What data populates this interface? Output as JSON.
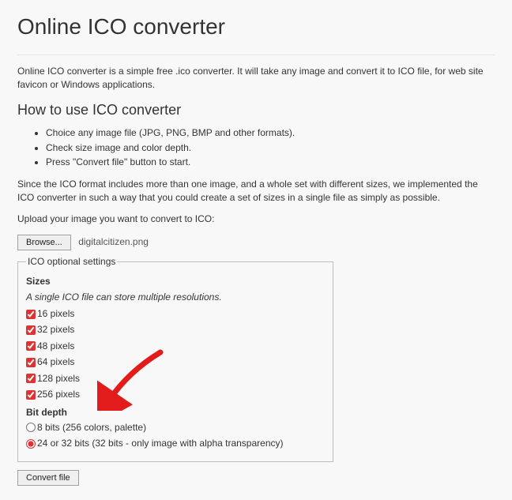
{
  "header": {
    "title": "Online ICO converter"
  },
  "intro": "Online ICO converter is a simple free .ico converter. It will take any image and convert it to ICO file, for web site favicon or Windows applications.",
  "howto": {
    "heading": "How to use ICO converter",
    "steps": [
      "Choice any image file (JPG, PNG, BMP and other formats).",
      "Check size image and color depth.",
      "Press \"Convert file\" button to start."
    ]
  },
  "note": "Since the ICO format includes more than one image, and a whole set with different sizes, we implemented the ICO converter in such a way that you could create a set of sizes in a single file as simply as possible.",
  "upload": {
    "label": "Upload your image you want to convert to ICO:",
    "browse_label": "Browse...",
    "filename": "digitalcitizen.png"
  },
  "settings": {
    "legend": "ICO optional settings",
    "sizes": {
      "title": "Sizes",
      "subtitle": "A single ICO file can store multiple resolutions.",
      "options": [
        {
          "label": "16 pixels",
          "checked": true
        },
        {
          "label": "32 pixels",
          "checked": true
        },
        {
          "label": "48 pixels",
          "checked": true
        },
        {
          "label": "64 pixels",
          "checked": true
        },
        {
          "label": "128 pixels",
          "checked": true
        },
        {
          "label": "256 pixels",
          "checked": true
        }
      ]
    },
    "bitdepth": {
      "title": "Bit depth",
      "options": [
        {
          "label": "8 bits (256 colors, palette)",
          "selected": false
        },
        {
          "label": "24 or 32 bits (32 bits - only image with alpha transparency)",
          "selected": true
        }
      ]
    }
  },
  "actions": {
    "convert_label": "Convert file"
  },
  "annotation": {
    "arrow_color": "#e21b1b"
  }
}
